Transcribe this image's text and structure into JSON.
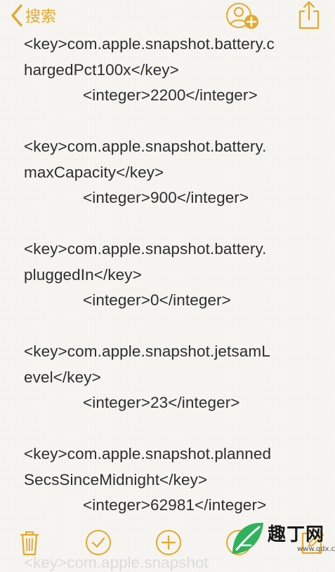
{
  "nav": {
    "back_label": "搜索"
  },
  "note": {
    "entries": [
      {
        "key_lines": [
          "<key>com.apple.snapshot.battery.c",
          "hargedPct100x</key>"
        ],
        "value_line": "<integer>2200</integer>"
      },
      {
        "key_lines": [
          "<key>com.apple.snapshot.battery.",
          "maxCapacity</key>"
        ],
        "value_line": "<integer>900</integer>"
      },
      {
        "key_lines": [
          "<key>com.apple.snapshot.battery.",
          "pluggedIn</key>"
        ],
        "value_line": "<integer>0</integer>"
      },
      {
        "key_lines": [
          "<key>com.apple.snapshot.jetsamL",
          "evel</key>"
        ],
        "value_line": "<integer>23</integer>"
      },
      {
        "key_lines": [
          "<key>com.apple.snapshot.planned",
          "SecsSinceMidnight</key>"
        ],
        "value_line": "<integer>62981</integer>"
      }
    ],
    "partial_next_line": "<key>com.apple.snapshot"
  },
  "colors": {
    "accent": "#e3a92b",
    "text": "#2e2e2e",
    "background": "#f7f6f2"
  },
  "watermark": {
    "text": "趣丁网",
    "url": "www.qdx.com"
  }
}
